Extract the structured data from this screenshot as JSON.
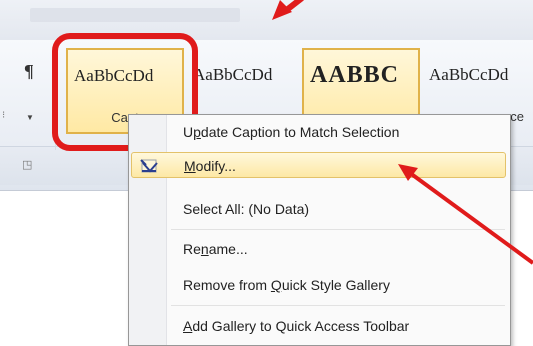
{
  "ribbon": {
    "pilcrow_glyph": "¶",
    "styles": [
      {
        "sample": "AaBbCcDd",
        "label": "Capt",
        "selected": true
      },
      {
        "sample": "AaBbCcDd",
        "label": ""
      },
      {
        "sample": "AABBC",
        "label": "",
        "selected": true
      },
      {
        "sample": "AaBbCcDd",
        "label": "ce"
      }
    ]
  },
  "context_menu": {
    "items": [
      {
        "pre": "U",
        "accel": "p",
        "post": "date Caption to Match Selection",
        "icon": "none"
      },
      {
        "pre": "",
        "accel": "M",
        "post": "odify...",
        "icon": "modify-style-icon",
        "highlighted": true
      },
      {
        "pre": "Select All: (No Data)",
        "accel": "",
        "post": "",
        "icon": "none"
      },
      {
        "pre": "Re",
        "accel": "n",
        "post": "ame...",
        "icon": "none"
      },
      {
        "pre": "Remove from ",
        "accel": "Q",
        "post": "uick Style Gallery",
        "icon": "none"
      },
      {
        "pre": "",
        "accel": "A",
        "post": "dd Gallery to Quick Access Toolbar",
        "icon": "none"
      }
    ]
  },
  "annotations": {
    "highlight_color": "#e01b1b"
  }
}
